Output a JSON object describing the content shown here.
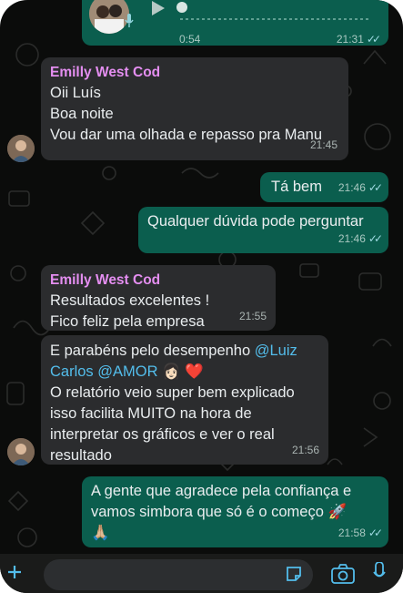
{
  "colors": {
    "background": "#0b0c0b",
    "incoming_bubble": "#2b2c2e",
    "outgoing_bubble": "#0b5e4e",
    "sender_name": "#e48ef0",
    "mention": "#53bdeb",
    "read_ticks": "#9fdbe3"
  },
  "audio_message": {
    "duration": "0:54",
    "time": "21:31",
    "status": "read",
    "progress": 0.0,
    "icons": [
      "avatar-photo",
      "microphone-icon",
      "play-icon"
    ]
  },
  "messages": [
    {
      "type": "incoming",
      "sender": "Emilly West Cod",
      "lines": [
        "Oii Luís",
        "Boa noite",
        "Vou dar uma olhada e repasso pra Manu"
      ],
      "time": "21:45",
      "avatar": true
    },
    {
      "type": "outgoing",
      "text": "Tá bem",
      "time": "21:46",
      "status": "read"
    },
    {
      "type": "outgoing",
      "text": "Qualquer dúvida pode perguntar",
      "time": "21:46",
      "status": "read"
    },
    {
      "type": "incoming",
      "sender": "Emilly West Cod",
      "lines": [
        "Resultados excelentes !",
        "Fico feliz pela empresa"
      ],
      "time": "21:55"
    },
    {
      "type": "incoming",
      "line1_prefix": "E parabéns pelo desempenho ",
      "mention1_part1": "@Luiz",
      "mention1_part2": "Carlos",
      "mention2": "@AMOR",
      "emojis": [
        "👩🏻",
        "❤️"
      ],
      "rest_lines": [
        "O relatório veio super bem explicado",
        "isso facilita MUITO na hora de",
        "interpretar os gráficos e ver o real",
        "resultado"
      ],
      "time": "21:56",
      "avatar": true
    },
    {
      "type": "outgoing",
      "lines": [
        "A gente que agradece pela confiança e",
        "vamos simbora que só é o começo"
      ],
      "emojis": [
        "🚀",
        "🙏🏼"
      ],
      "time": "21:58",
      "status": "read"
    }
  ],
  "composer": {
    "placeholder": "",
    "icons": [
      "plus-icon",
      "sticker-icon",
      "camera-icon",
      "microphone-icon"
    ]
  }
}
